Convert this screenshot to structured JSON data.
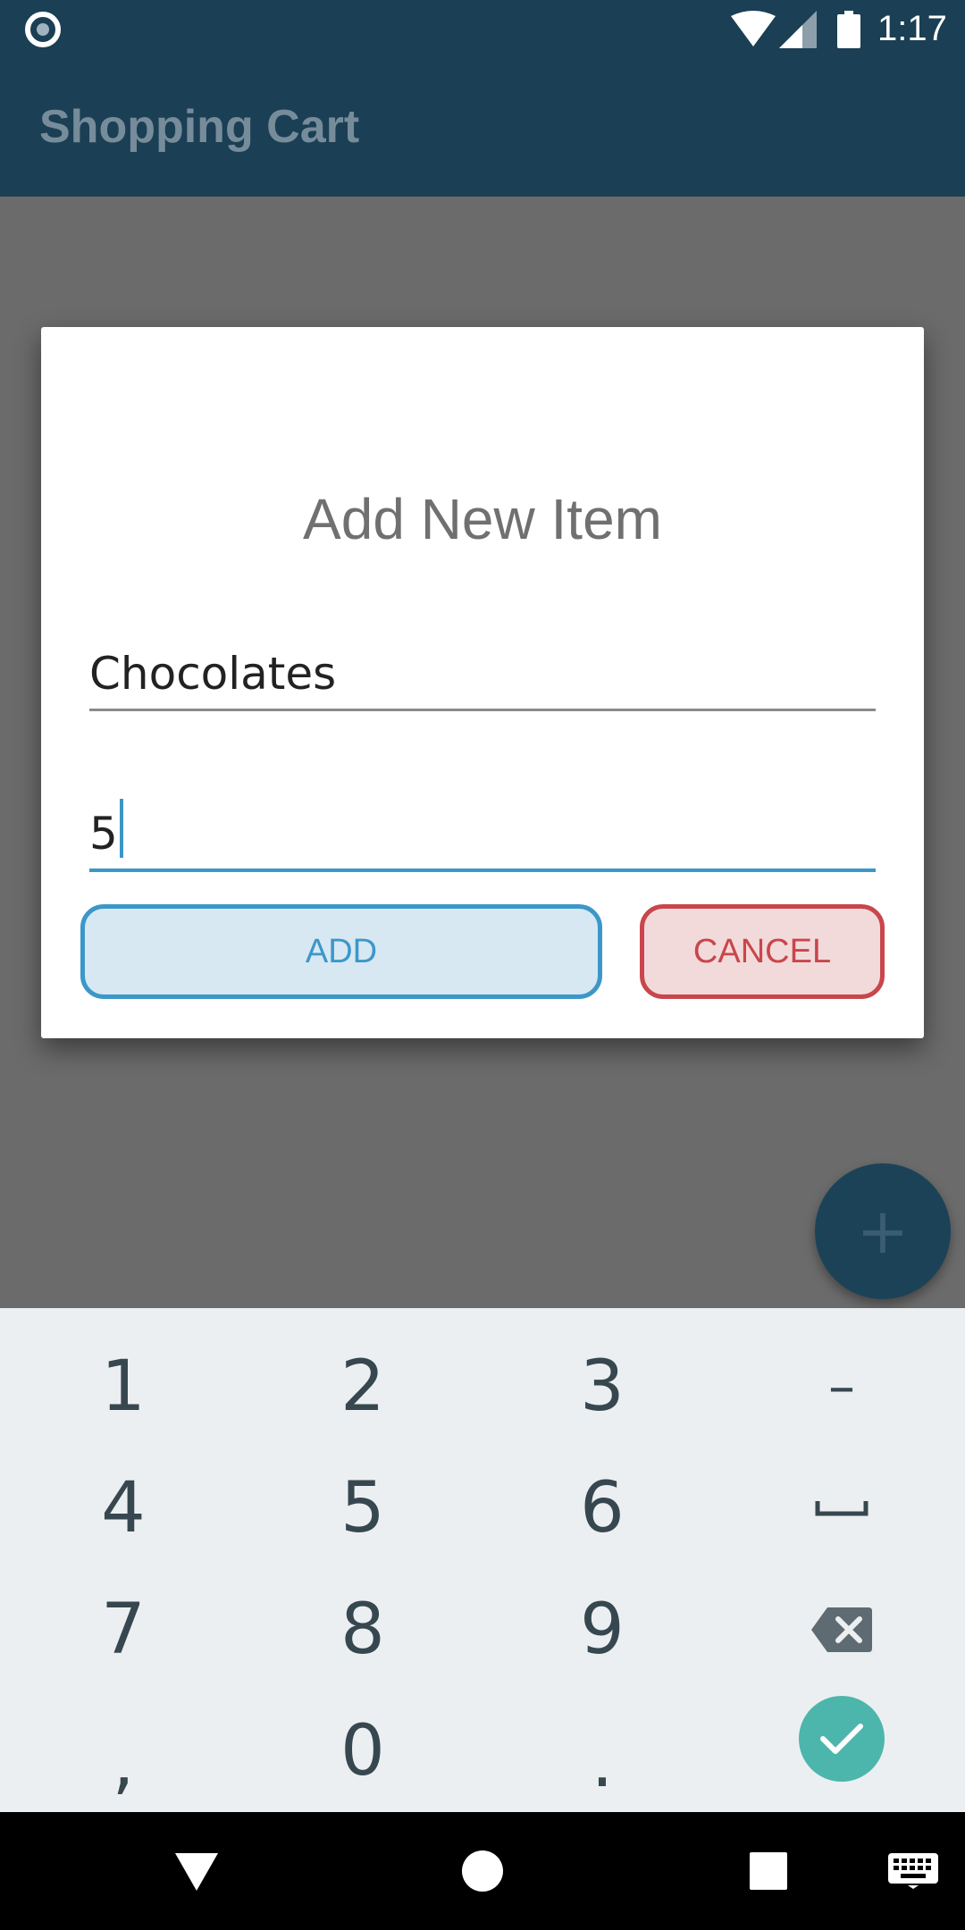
{
  "status_bar": {
    "time": "1:17"
  },
  "app_bar": {
    "title": "Shopping Cart"
  },
  "dialog": {
    "title": "Add New Item",
    "item_name_value": "Chocolates",
    "quantity_value": "5",
    "add_label": "ADD",
    "cancel_label": "CANCEL"
  },
  "fab": {
    "icon": "plus-icon",
    "symbol": "+"
  },
  "keyboard": {
    "row1": [
      "1",
      "2",
      "3",
      "–"
    ],
    "row2": [
      "4",
      "5",
      "6",
      "space"
    ],
    "row3": [
      "7",
      "8",
      "9",
      "backspace"
    ],
    "row4": [
      ",",
      "0",
      ".",
      "done"
    ]
  },
  "colors": {
    "app_bar": "#1b3f54",
    "accent_blue": "#3c97c9",
    "accent_red": "#c8464c",
    "done_green": "#4db6ac"
  }
}
